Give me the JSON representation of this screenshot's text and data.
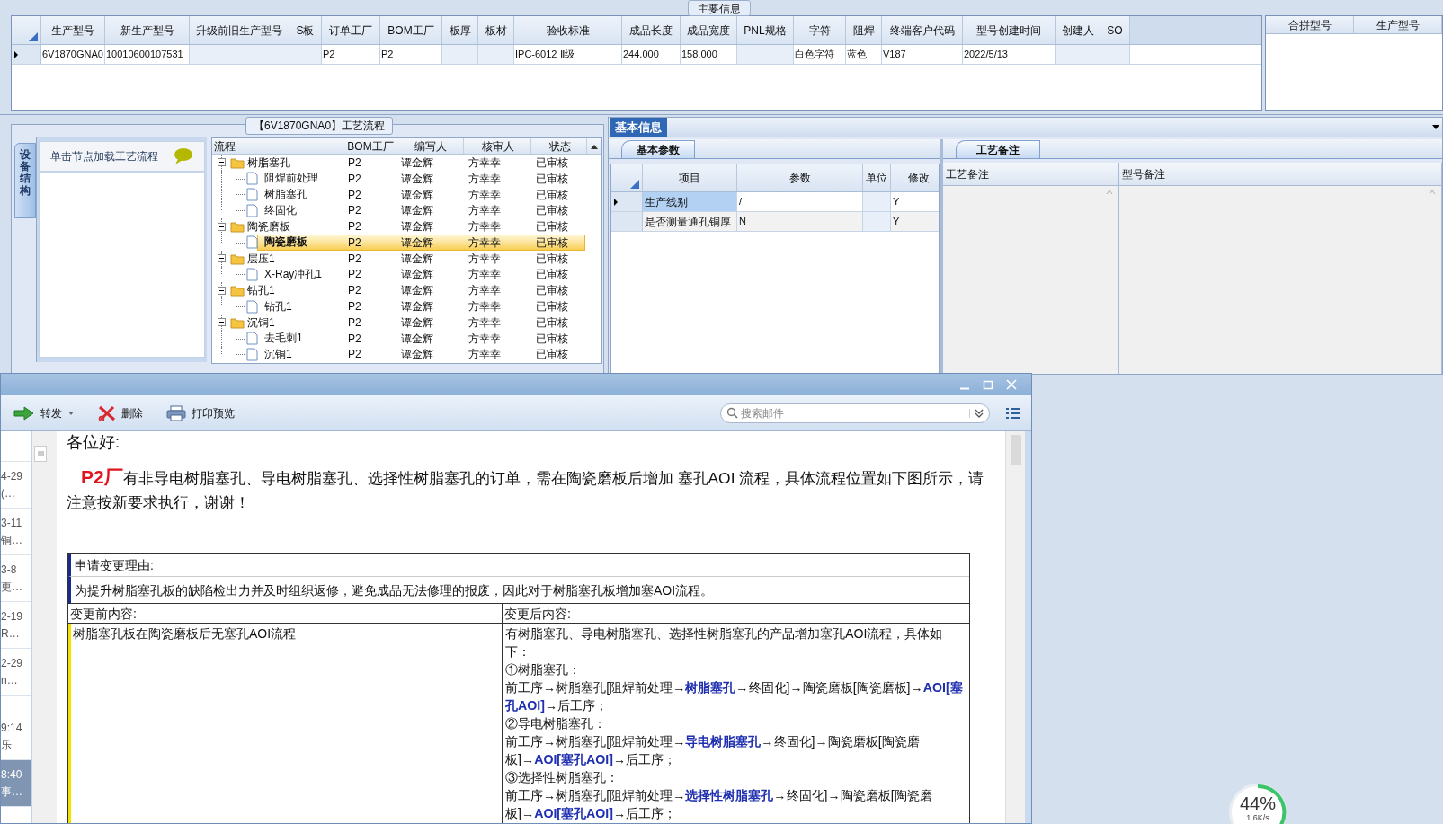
{
  "main_info": {
    "title": "主要信息",
    "columns": [
      "生产型号",
      "新生产型号",
      "升级前旧生产型号",
      "S板",
      "订单工厂",
      "BOM工厂",
      "板厚",
      "板材",
      "验收标准",
      "成品长度",
      "成品宽度",
      "PNL规格",
      "字符",
      "阻焊",
      "终端客户代码",
      "型号创建时间",
      "创建人",
      "SO"
    ],
    "rows": [
      {
        "selected": true,
        "cells": [
          "6V1870GNA0",
          "10010600107531",
          null,
          null,
          "P2",
          "P2",
          null,
          null,
          "IPC-6012 Ⅱ级",
          "244.000",
          "158.000",
          null,
          "白色字符",
          "蓝色",
          "V187",
          "2022/5/13",
          null,
          null
        ]
      }
    ]
  },
  "merge_table": {
    "columns": [
      "合拼型号",
      "生产型号"
    ]
  },
  "process_flow": {
    "title": "【6V1870GNA0】工艺流程",
    "side_tab": "设备结构",
    "hint": "单击节点加载工艺流程",
    "columns": [
      "流程",
      "BOM工厂",
      "编写人",
      "核审人",
      "状态"
    ],
    "tree": [
      {
        "name": "树脂塞孔",
        "factory": "P2",
        "writer": "谭金辉",
        "reviewer": "方幸幸",
        "status": "已审核",
        "expanded": true,
        "selected": false,
        "children": [
          {
            "name": "阻焊前处理",
            "factory": "P2",
            "writer": "谭金辉",
            "reviewer": "方幸幸",
            "status": "已审核",
            "selected": false
          },
          {
            "name": "树脂塞孔",
            "factory": "P2",
            "writer": "谭金辉",
            "reviewer": "方幸幸",
            "status": "已审核",
            "selected": false
          },
          {
            "name": "终固化",
            "factory": "P2",
            "writer": "谭金辉",
            "reviewer": "方幸幸",
            "status": "已审核",
            "selected": false
          }
        ]
      },
      {
        "name": "陶瓷磨板",
        "factory": "P2",
        "writer": "谭金辉",
        "reviewer": "方幸幸",
        "status": "已审核",
        "expanded": true,
        "selected": false,
        "children": [
          {
            "name": "陶瓷磨板",
            "factory": "P2",
            "writer": "谭金辉",
            "reviewer": "方幸幸",
            "status": "已审核",
            "selected": true
          }
        ]
      },
      {
        "name": "层压1",
        "factory": "P2",
        "writer": "谭金辉",
        "reviewer": "方幸幸",
        "status": "已审核",
        "expanded": true,
        "selected": false,
        "children": [
          {
            "name": "X-Ray冲孔1",
            "factory": "P2",
            "writer": "谭金辉",
            "reviewer": "方幸幸",
            "status": "已审核",
            "selected": false
          }
        ]
      },
      {
        "name": "钻孔1",
        "factory": "P2",
        "writer": "谭金辉",
        "reviewer": "方幸幸",
        "status": "已审核",
        "expanded": true,
        "selected": false,
        "children": [
          {
            "name": "钻孔1",
            "factory": "P2",
            "writer": "谭金辉",
            "reviewer": "方幸幸",
            "status": "已审核",
            "selected": false
          }
        ]
      },
      {
        "name": "沉铜1",
        "factory": "P2",
        "writer": "谭金辉",
        "reviewer": "方幸幸",
        "status": "已审核",
        "expanded": true,
        "selected": false,
        "children": [
          {
            "name": "去毛刺1",
            "factory": "P2",
            "writer": "谭金辉",
            "reviewer": "方幸幸",
            "status": "已审核",
            "selected": false
          },
          {
            "name": "沉铜1",
            "factory": "P2",
            "writer": "谭金辉",
            "reviewer": "方幸幸",
            "status": "已审核",
            "selected": false
          }
        ]
      }
    ]
  },
  "basic_info": {
    "title": "基本信息",
    "tab": "基本参数",
    "columns": [
      "项目",
      "参数",
      "单位",
      "修改"
    ],
    "rows": [
      {
        "selected": true,
        "cells": [
          "生产线别",
          "/",
          null,
          "Y"
        ]
      },
      {
        "selected": false,
        "cells": [
          "是否测量通孔铜厚",
          "N",
          null,
          "Y"
        ]
      }
    ]
  },
  "remarks": {
    "tab": "工艺备注",
    "columns": [
      "工艺备注",
      "型号备注"
    ]
  },
  "mail": {
    "toolbar": [
      {
        "kind": "forward",
        "label": "转发"
      },
      {
        "kind": "delete",
        "label": "删除"
      },
      {
        "kind": "print",
        "label": "打印预览"
      }
    ],
    "search": {
      "placeholder": "搜索邮件"
    },
    "list": [
      {
        "date": "4-29",
        "snippet": "(…",
        "selected": false
      },
      {
        "date": "3-11",
        "snippet": "铜…",
        "selected": false
      },
      {
        "date": "3-8",
        "snippet": "更…",
        "selected": false
      },
      {
        "date": "2-19",
        "snippet": "R…",
        "selected": false
      },
      {
        "date": "2-29",
        "snippet": "n…",
        "selected": false
      },
      {
        "date": "9:14",
        "snippet": "乐",
        "selected": false
      },
      {
        "date": "8:40",
        "snippet": "事…",
        "selected": true
      }
    ],
    "greeting": "各位好:",
    "lead": "P2厂",
    "intro": "有非导电树脂塞孔、导电树脂塞孔、选择性树脂塞孔的订单，需在陶瓷磨板后增加 塞孔AOI 流程，具体流程位置如下图所示，请注意按新要求执行，谢谢！",
    "form": {
      "reason_label": "申请变更理由:",
      "reason": "为提升树脂塞孔板的缺陷检出力并及时组织返修，避免成品无法修理的报废，因此对于树脂塞孔板增加塞AOI流程。",
      "before_label": "变更前内容:",
      "after_label": "变更后内容:",
      "before": "树脂塞孔板在陶瓷磨板后无塞孔AOI流程",
      "after": [
        "有树脂塞孔、导电树脂塞孔、选择性树脂塞孔的产品增加塞孔AOI流程，具体如下：",
        "①树脂塞孔：",
        "前工序→树脂塞孔[阻焊前处理→**树脂塞孔**→终固化]→陶瓷磨板[陶瓷磨板]→**AOI[塞孔AOI]**→后工序；",
        "②导电树脂塞孔：",
        "前工序→树脂塞孔[阻焊前处理→**导电树脂塞孔**→终固化]→陶瓷磨板[陶瓷磨板]→**AOI[塞孔AOI]**→后工序；",
        "③选择性树脂塞孔：",
        "前工序→树脂塞孔[阻焊前处理→**选择性树脂塞孔**→终固化]→陶瓷磨板[陶瓷磨板]→**AOI[塞孔AOI]**→后工序；"
      ]
    }
  },
  "network": {
    "percent": "44%",
    "speed": "1.6K/s"
  }
}
